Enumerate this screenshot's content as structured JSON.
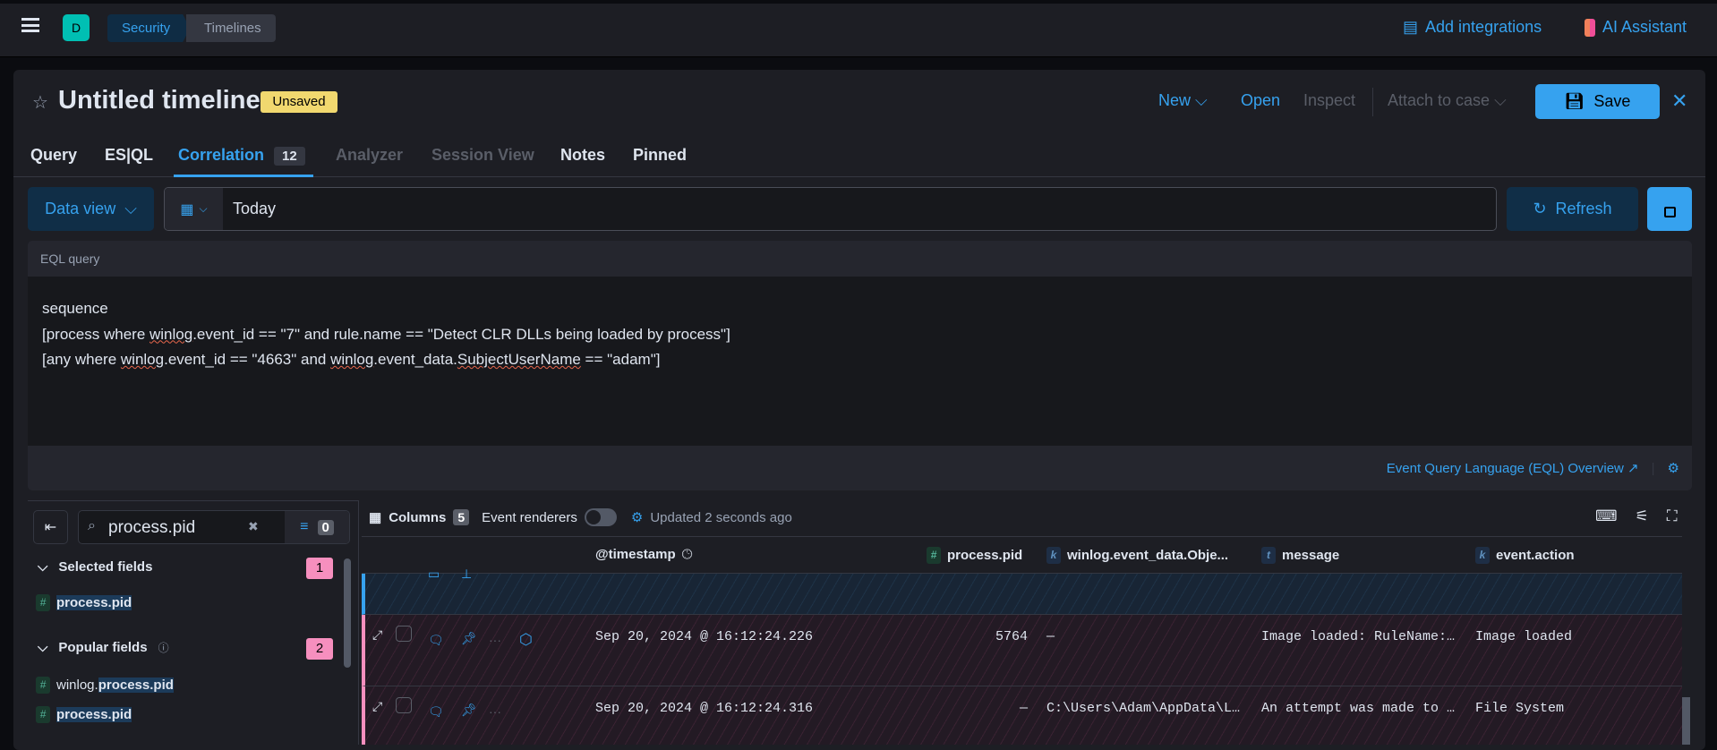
{
  "topbar": {
    "space_initial": "D",
    "breadcrumbs": [
      "Security",
      "Timelines"
    ],
    "add_integrations": "Add integrations",
    "ai_assistant": "AI Assistant"
  },
  "header": {
    "title": "Untitled timeline",
    "status": "Unsaved",
    "new": "New",
    "open": "Open",
    "inspect": "Inspect",
    "attach": "Attach to case",
    "save": "Save"
  },
  "tabs": [
    {
      "label": "Query"
    },
    {
      "label": "ES|QL"
    },
    {
      "label": "Correlation",
      "count": "12",
      "active": true
    },
    {
      "label": "Analyzer",
      "disabled": true
    },
    {
      "label": "Session View",
      "disabled": true
    },
    {
      "label": "Notes"
    },
    {
      "label": "Pinned"
    }
  ],
  "querybar": {
    "data_view": "Data view",
    "date": "Today",
    "refresh": "Refresh"
  },
  "eql": {
    "label": "EQL query",
    "lines": [
      [
        {
          "t": "sequence"
        }
      ],
      [
        {
          "t": "[process where "
        },
        {
          "t": "winlog",
          "w": true
        },
        {
          "t": ".event_id == \"7\" and rule.name == \"Detect CLR DLLs being loaded by process\"]"
        }
      ],
      [
        {
          "t": "[any where "
        },
        {
          "t": "winlog",
          "w": true
        },
        {
          "t": ".event_id == \"4663\" and "
        },
        {
          "t": "winlog",
          "w": true
        },
        {
          "t": ".event_data."
        },
        {
          "t": "SubjectUserName",
          "w": true
        },
        {
          "t": " == \"adam\"]"
        }
      ]
    ],
    "overview_link": "Event Query Language (EQL) Overview"
  },
  "sidebar": {
    "search_value": "process.pid",
    "filter_count": "0",
    "selected_label": "Selected fields",
    "selected_count": "1",
    "selected_fields": [
      "process.pid"
    ],
    "popular_label": "Popular fields",
    "popular_count": "2",
    "popular_fields": [
      {
        "prefix": "winlog.",
        "match": "process.pid"
      },
      {
        "prefix": "",
        "match": "process.pid"
      }
    ]
  },
  "toolbar": {
    "columns": "Columns",
    "columns_count": "5",
    "event_renderers": "Event renderers",
    "event_renderers_on": false,
    "updated": "Updated 2 seconds ago"
  },
  "table": {
    "columns": [
      {
        "label": "@timestamp",
        "type": ""
      },
      {
        "label": "process.pid",
        "type": "#"
      },
      {
        "label": "winlog.event_data.Obje...",
        "type": "k"
      },
      {
        "label": "message",
        "type": "t"
      },
      {
        "label": "event.action",
        "type": "k"
      }
    ],
    "rows": [
      {
        "timestamp": "",
        "pid": "",
        "object": "",
        "message": "",
        "action": ""
      },
      {
        "timestamp": "Sep 20, 2024 @ 16:12:24.226",
        "pid": "5764",
        "object": "—",
        "message": "Image loaded: RuleName:…",
        "action": "Image loaded"
      },
      {
        "timestamp": "Sep 20, 2024 @ 16:12:24.316",
        "pid": "—",
        "object": "C:\\Users\\Adam\\AppData\\L…",
        "message": "An attempt was made to …",
        "action": "File System"
      }
    ]
  },
  "colors": {
    "accent": "#36a2ef",
    "sequence_highlight": "#f68fbe",
    "unsaved": "#f1d86f"
  }
}
